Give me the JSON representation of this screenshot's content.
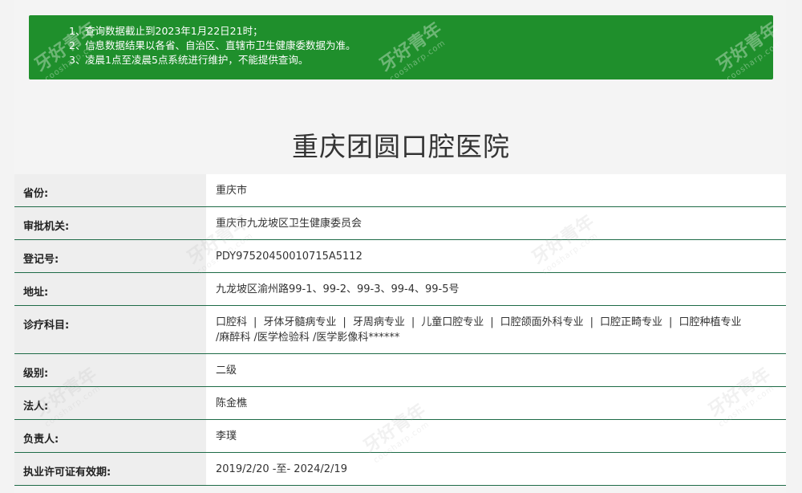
{
  "notice": {
    "lines": [
      {
        "num": "1、",
        "text": "查询数据截止到2023年1月22日21时；"
      },
      {
        "num": "2、",
        "text": "信息数据结果以各省、自治区、直辖市卫生健康委数据为准。"
      },
      {
        "num": "3、",
        "text": "凌晨1点至凌晨5点系统进行维护，不能提供查询。"
      }
    ],
    "background_color": "#1f8f2c"
  },
  "hospital_name": "重庆团圆口腔医院",
  "fields": {
    "province": {
      "label": "省份:",
      "value": "重庆市"
    },
    "authority": {
      "label": "审批机关:",
      "value": "重庆市九龙坡区卫生健康委员会"
    },
    "registration": {
      "label": "登记号:",
      "value": "PDY97520450010715A5112"
    },
    "address": {
      "label": "地址:",
      "value": "九龙坡区渝州路99-1、99-2、99-3、99-4、99-5号"
    },
    "departments": {
      "label": "诊疗科目:",
      "items": [
        "口腔科",
        "牙体牙髓病专业",
        "牙周病专业",
        "儿童口腔专业",
        "口腔颌面外科专业",
        "口腔正畸专业",
        "口腔种植专业"
      ],
      "separator": "|",
      "tail": "/麻醉科 /医学检验科 /医学影像科******"
    },
    "level": {
      "label": "级别:",
      "value": "二级"
    },
    "legal_person": {
      "label": "法人:",
      "value": "陈金樵"
    },
    "responsible": {
      "label": "负责人:",
      "value": "李璞"
    },
    "license_validity": {
      "label": "执业许可证有效期:",
      "value": "2019/2/20 -至- 2024/2/19"
    }
  },
  "watermark": {
    "text": "牙好青年",
    "sub": "coosharp.com"
  },
  "colors": {
    "accent_green": "#1f8f2c",
    "row_divider": "#1e6b47"
  }
}
